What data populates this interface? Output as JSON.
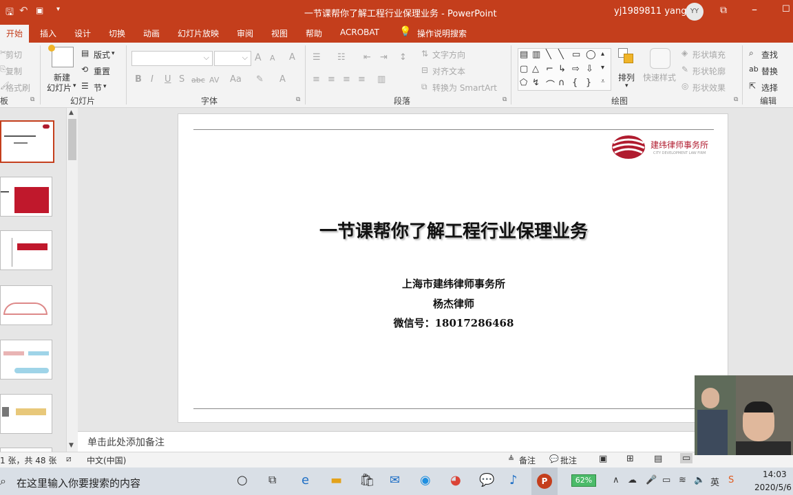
{
  "window": {
    "title": "一节课帮你了解工程行业保理业务  -  PowerPoint",
    "user_name": "yj1989811 yang",
    "user_initials": "YY"
  },
  "tabs": [
    "开始",
    "插入",
    "设计",
    "切换",
    "动画",
    "幻灯片放映",
    "审阅",
    "视图",
    "帮助",
    "ACROBAT"
  ],
  "tell_me": "操作说明搜索",
  "ribbon": {
    "clipboard": {
      "cut": "剪切",
      "copy": "复制",
      "format_painter": "格式刷",
      "group": "板"
    },
    "slides": {
      "new_slide_1": "新建",
      "new_slide_2": "幻灯片",
      "layout": "版式",
      "reset": "重置",
      "section": "节",
      "group": "幻灯片"
    },
    "font": {
      "bold": "B",
      "italic": "I",
      "underline": "U",
      "strike": "S",
      "abc": "abc",
      "spacing": "AV",
      "case": "Aa",
      "grow": "A",
      "shrink": "A",
      "clear": "A",
      "color": "A",
      "group": "字体"
    },
    "paragraph": {
      "text_direction": "文字方向",
      "align_text": "对齐文本",
      "smartart": "转换为 SmartArt",
      "group": "段落"
    },
    "drawing": {
      "arrange": "排列",
      "quick_styles": "快速样式",
      "shape_fill": "形状填充",
      "shape_outline": "形状轮廓",
      "shape_effects": "形状效果",
      "group": "绘图"
    },
    "editing": {
      "find": "查找",
      "replace": "替换",
      "select": "选择",
      "group": "编辑"
    }
  },
  "slide": {
    "logo_text": "建纬律师事务所",
    "logo_sub": "CITY DEVELOPMENT  LAW FIRM",
    "title": "一节课帮你了解工程行业保理业务",
    "line1": "上海市建纬律师事务所",
    "line2": "杨杰律师",
    "line3": "微信号：18017286468"
  },
  "notes_placeholder": "单击此处添加备注",
  "statusbar": {
    "slide_info": "1 张，共 48 张",
    "language": "中文(中国)",
    "notes": "备注",
    "comments": "批注"
  },
  "taskbar": {
    "search_placeholder": "在这里输入你要搜索的内容",
    "battery": "62%",
    "time": "14:03",
    "date": "2020/5/6"
  },
  "colors": {
    "accent": "#c43e1c",
    "logo_red": "#b01b2e"
  }
}
